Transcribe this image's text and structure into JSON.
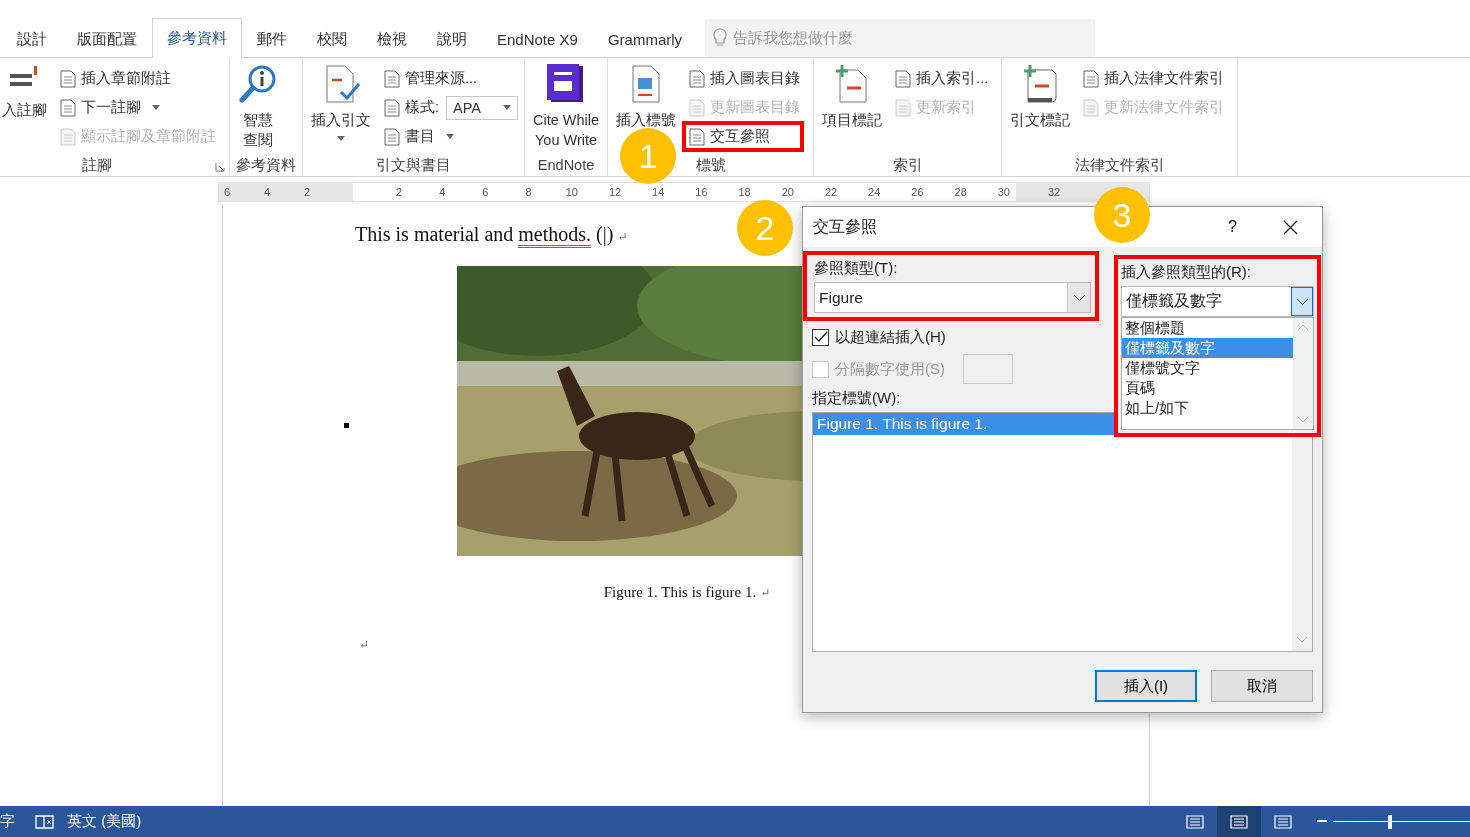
{
  "tabs": [
    {
      "label": "設計",
      "selected": false
    },
    {
      "label": "版面配置",
      "selected": false
    },
    {
      "label": "參考資料",
      "selected": true
    },
    {
      "label": "郵件",
      "selected": false
    },
    {
      "label": "校閱",
      "selected": false
    },
    {
      "label": "檢視",
      "selected": false
    },
    {
      "label": "說明",
      "selected": false
    },
    {
      "label": "EndNote X9",
      "selected": false
    },
    {
      "label": "Grammarly",
      "selected": false
    }
  ],
  "tell_me": {
    "placeholder": "告訴我您想做什麼"
  },
  "ribbon": {
    "groups": [
      {
        "label": "註腳",
        "dialog_launcher": true,
        "big": [
          {
            "label": "入註腳",
            "dropdown": false
          }
        ],
        "small": [
          {
            "kind": "button",
            "label": "插入章節附註",
            "disabled": false,
            "dropdown": false,
            "highlighted": false
          },
          {
            "kind": "button",
            "label": "下一註腳",
            "disabled": false,
            "dropdown": true,
            "highlighted": false
          },
          {
            "kind": "button",
            "label": "顯示註腳及章節附註",
            "disabled": true,
            "dropdown": false,
            "highlighted": false
          }
        ]
      },
      {
        "label": "參考資料",
        "big": [
          {
            "label": "智慧查閱",
            "dropdown": false
          }
        ]
      },
      {
        "label": "引文與書目",
        "big": [
          {
            "label": "插入引文",
            "dropdown": true
          }
        ],
        "small": [
          {
            "kind": "button",
            "label": "管理來源...",
            "disabled": false,
            "dropdown": false,
            "highlighted": false
          },
          {
            "kind": "combo",
            "label": "樣式:",
            "value": "APA",
            "disabled": false,
            "highlighted": false
          },
          {
            "kind": "button",
            "label": "書目",
            "disabled": false,
            "dropdown": true,
            "highlighted": false
          }
        ]
      },
      {
        "label": "EndNote",
        "big": [
          {
            "label": "Cite While\nYou Write",
            "dropdown": false
          }
        ]
      },
      {
        "label": "標號",
        "big": [
          {
            "label": "插入標號",
            "dropdown": false
          }
        ],
        "small": [
          {
            "kind": "button",
            "label": "插入圖表目錄",
            "disabled": false,
            "dropdown": false,
            "highlighted": false
          },
          {
            "kind": "button",
            "label": "更新圖表目錄",
            "disabled": true,
            "dropdown": false,
            "highlighted": false
          },
          {
            "kind": "button",
            "label": "交互參照",
            "disabled": false,
            "dropdown": false,
            "highlighted": true,
            "badge": "1"
          }
        ]
      },
      {
        "label": "索引",
        "big": [
          {
            "label": "項目標記",
            "dropdown": false
          }
        ],
        "small": [
          {
            "kind": "button",
            "label": "插入索引...",
            "disabled": false,
            "dropdown": false,
            "highlighted": false
          },
          {
            "kind": "button",
            "label": "更新索引",
            "disabled": true,
            "dropdown": false,
            "highlighted": false
          }
        ]
      },
      {
        "label": "法律文件索引",
        "big": [
          {
            "label": "引文標記",
            "dropdown": false
          }
        ],
        "small": [
          {
            "kind": "button",
            "label": "插入法律文件索引",
            "disabled": false,
            "dropdown": false,
            "highlighted": false
          },
          {
            "kind": "button",
            "label": "更新法律文件索引",
            "disabled": true,
            "dropdown": false,
            "highlighted": false
          }
        ]
      }
    ]
  },
  "ruler": {
    "left_numbers": [
      "6",
      "4",
      "2"
    ],
    "numbers": [
      "2",
      "4",
      "6",
      "8",
      "10",
      "12",
      "14",
      "16",
      "18",
      "20",
      "22",
      "24",
      "26",
      "28",
      "30"
    ],
    "right_numbers": [
      "32"
    ]
  },
  "document": {
    "sentence": "This is material and ",
    "flagged_word": "methods.",
    "tail": " (|)",
    "paragraph_mark": "↵",
    "caption": "Figure 1. This is figure 1.",
    "caption_mark": "↵",
    "empty_mark": "↵"
  },
  "dialog": {
    "title": "交互參照",
    "help": "?",
    "reference_type": {
      "label": "參照類型(T):",
      "value": "Figure",
      "highlighted": true,
      "badge": "2"
    },
    "options": [
      {
        "kind": "checkbox",
        "label": "以超連結插入(H)",
        "checked": true,
        "disabled": false
      },
      {
        "kind": "checkbox_field",
        "label": "分隔數字使用(S)",
        "checked": false,
        "disabled": true
      }
    ],
    "for_which": {
      "label": "指定標號(W):",
      "items": [
        {
          "text": "Figure 1. This is figure 1.",
          "selected": true
        }
      ]
    },
    "insert_as": {
      "label": "插入參照類型的(R):",
      "value": "僅標籤及數字",
      "open": true,
      "highlighted": true,
      "badge": "3",
      "options": [
        {
          "text": "整個標題",
          "selected": false
        },
        {
          "text": "僅標籤及數字",
          "selected": true
        },
        {
          "text": "僅標號文字",
          "selected": false
        },
        {
          "text": "頁碼",
          "selected": false
        },
        {
          "text": "如上/如下",
          "selected": false
        }
      ]
    },
    "buttons": [
      {
        "label": "插入(I)",
        "default": true
      },
      {
        "label": "取消",
        "default": false
      }
    ]
  },
  "status_bar": {
    "word_count": "字",
    "language": "英文 (美國)",
    "views": [
      {
        "selected": false
      },
      {
        "selected": true
      },
      {
        "selected": false
      }
    ]
  }
}
